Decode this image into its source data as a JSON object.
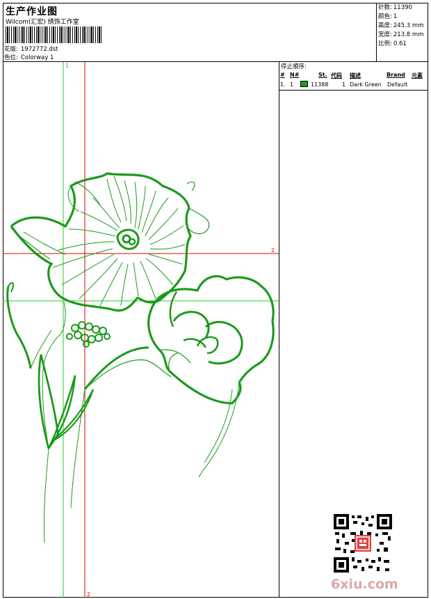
{
  "header": {
    "title": "生产作业图",
    "company": "Wilcom(汇宏) 绣饰工作室",
    "design_label": "花版:",
    "design_value": "1972772.dst",
    "colorway_label": "色位:",
    "colorway_value": "Colorway 1"
  },
  "stats": [
    {
      "label": "针数:",
      "value": "11390"
    },
    {
      "label": "颜色:",
      "value": "1"
    },
    {
      "label": "高度:",
      "value": "245.3 mm"
    },
    {
      "label": "宽度:",
      "value": "213.8 mm"
    },
    {
      "label": "比例:",
      "value": "0.61"
    }
  ],
  "stop_sequence": {
    "title": "停止顺序:",
    "headers": {
      "num": "#",
      "n": "N#",
      "st": "St.",
      "code": "代码",
      "desc": "描述",
      "brand": "Brand",
      "element": "元素"
    },
    "rows": [
      {
        "num": "1.",
        "n": "1",
        "st": "11388",
        "code": "1",
        "desc": "Dark Green",
        "brand": "Default",
        "color": "#1aa01a"
      }
    ]
  },
  "guides": {
    "green_vertical_label": "1",
    "red_vertical_label": "2",
    "red_horizontal_label": "2",
    "green_color": "#22cc22",
    "red_color": "#dd0000"
  },
  "thread_color": "#1a9a1a",
  "watermark": "6xiu.com"
}
